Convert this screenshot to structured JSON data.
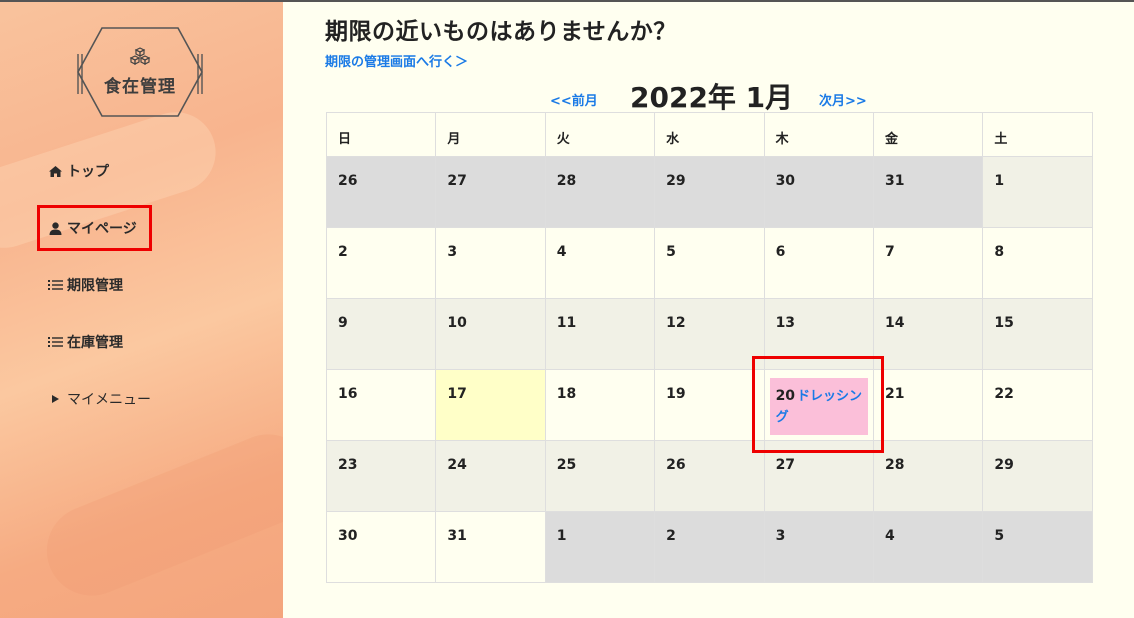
{
  "app": {
    "logo_text": "食在管理"
  },
  "sidebar": {
    "items": [
      {
        "label": "トップ",
        "icon": "home-icon"
      },
      {
        "label": "マイページ",
        "icon": "user-icon"
      },
      {
        "label": "期限管理",
        "icon": "list-icon"
      },
      {
        "label": "在庫管理",
        "icon": "list-icon"
      },
      {
        "label": "マイメニュー",
        "icon": "triangle-right-icon"
      }
    ]
  },
  "main": {
    "heading": "期限の近いものはありませんか？",
    "manage_link": "期限の管理画面へ行く＞"
  },
  "calendar": {
    "prev_label": "<<前月",
    "title": "2022年 1月",
    "next_label": "次月>>",
    "weekdays": [
      "日",
      "月",
      "火",
      "水",
      "木",
      "金",
      "土"
    ],
    "weeks": [
      [
        "26",
        "27",
        "28",
        "29",
        "30",
        "31",
        "1"
      ],
      [
        "2",
        "3",
        "4",
        "5",
        "6",
        "7",
        "8"
      ],
      [
        "9",
        "10",
        "11",
        "12",
        "13",
        "14",
        "15"
      ],
      [
        "16",
        "17",
        "18",
        "19",
        "20",
        "21",
        "22"
      ],
      [
        "23",
        "24",
        "25",
        "26",
        "27",
        "28",
        "29"
      ],
      [
        "30",
        "31",
        "1",
        "2",
        "3",
        "4",
        "5"
      ]
    ],
    "event": {
      "day": "20",
      "label": "ドレッシング"
    }
  },
  "colors": {
    "accent_link": "#1a7ae6",
    "highlight": "#ee0000",
    "event_bg": "#fbbfd9",
    "today_bg": "#ffffc8",
    "other_month_bg": "#dcdcdc"
  }
}
